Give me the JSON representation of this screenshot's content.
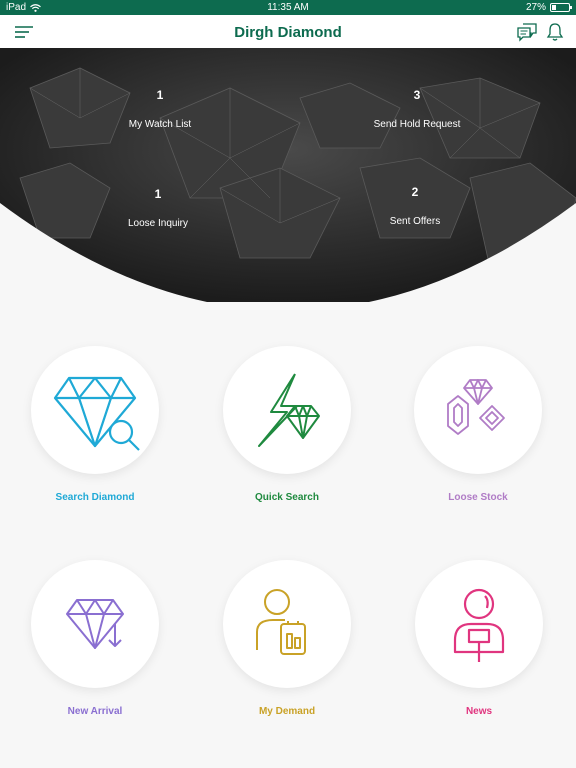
{
  "status_bar": {
    "device": "iPad",
    "time": "11:35 AM",
    "battery": "27%",
    "battery_level": 0.27
  },
  "nav": {
    "title": "Dirgh Diamond",
    "icons": [
      "menu-icon",
      "chat-icon",
      "bell-icon"
    ]
  },
  "stats": [
    {
      "count": "1",
      "label": "My Watch List"
    },
    {
      "count": "3",
      "label": "Send Hold Request"
    },
    {
      "count": "1",
      "label": "Loose Inquiry"
    },
    {
      "count": "2",
      "label": "Sent Offers"
    }
  ],
  "tiles": [
    {
      "label": "Search Diamond",
      "icon": "search-diamond-icon",
      "color": "#1fa9d6"
    },
    {
      "label": "Quick Search",
      "icon": "quick-search-icon",
      "color": "#1f8a3f"
    },
    {
      "label": "Loose Stock",
      "icon": "loose-stock-icon",
      "color": "#b07cc6"
    },
    {
      "label": "New Arrival",
      "icon": "new-arrival-icon",
      "color": "#8a6fd1"
    },
    {
      "label": "My Demand",
      "icon": "my-demand-icon",
      "color": "#c9a227"
    },
    {
      "label": "News",
      "icon": "news-icon",
      "color": "#e0357f"
    }
  ],
  "colors": {
    "brand": "#0d6b4f",
    "background": "#f7f7f7",
    "hero": "#2a2a2a"
  }
}
